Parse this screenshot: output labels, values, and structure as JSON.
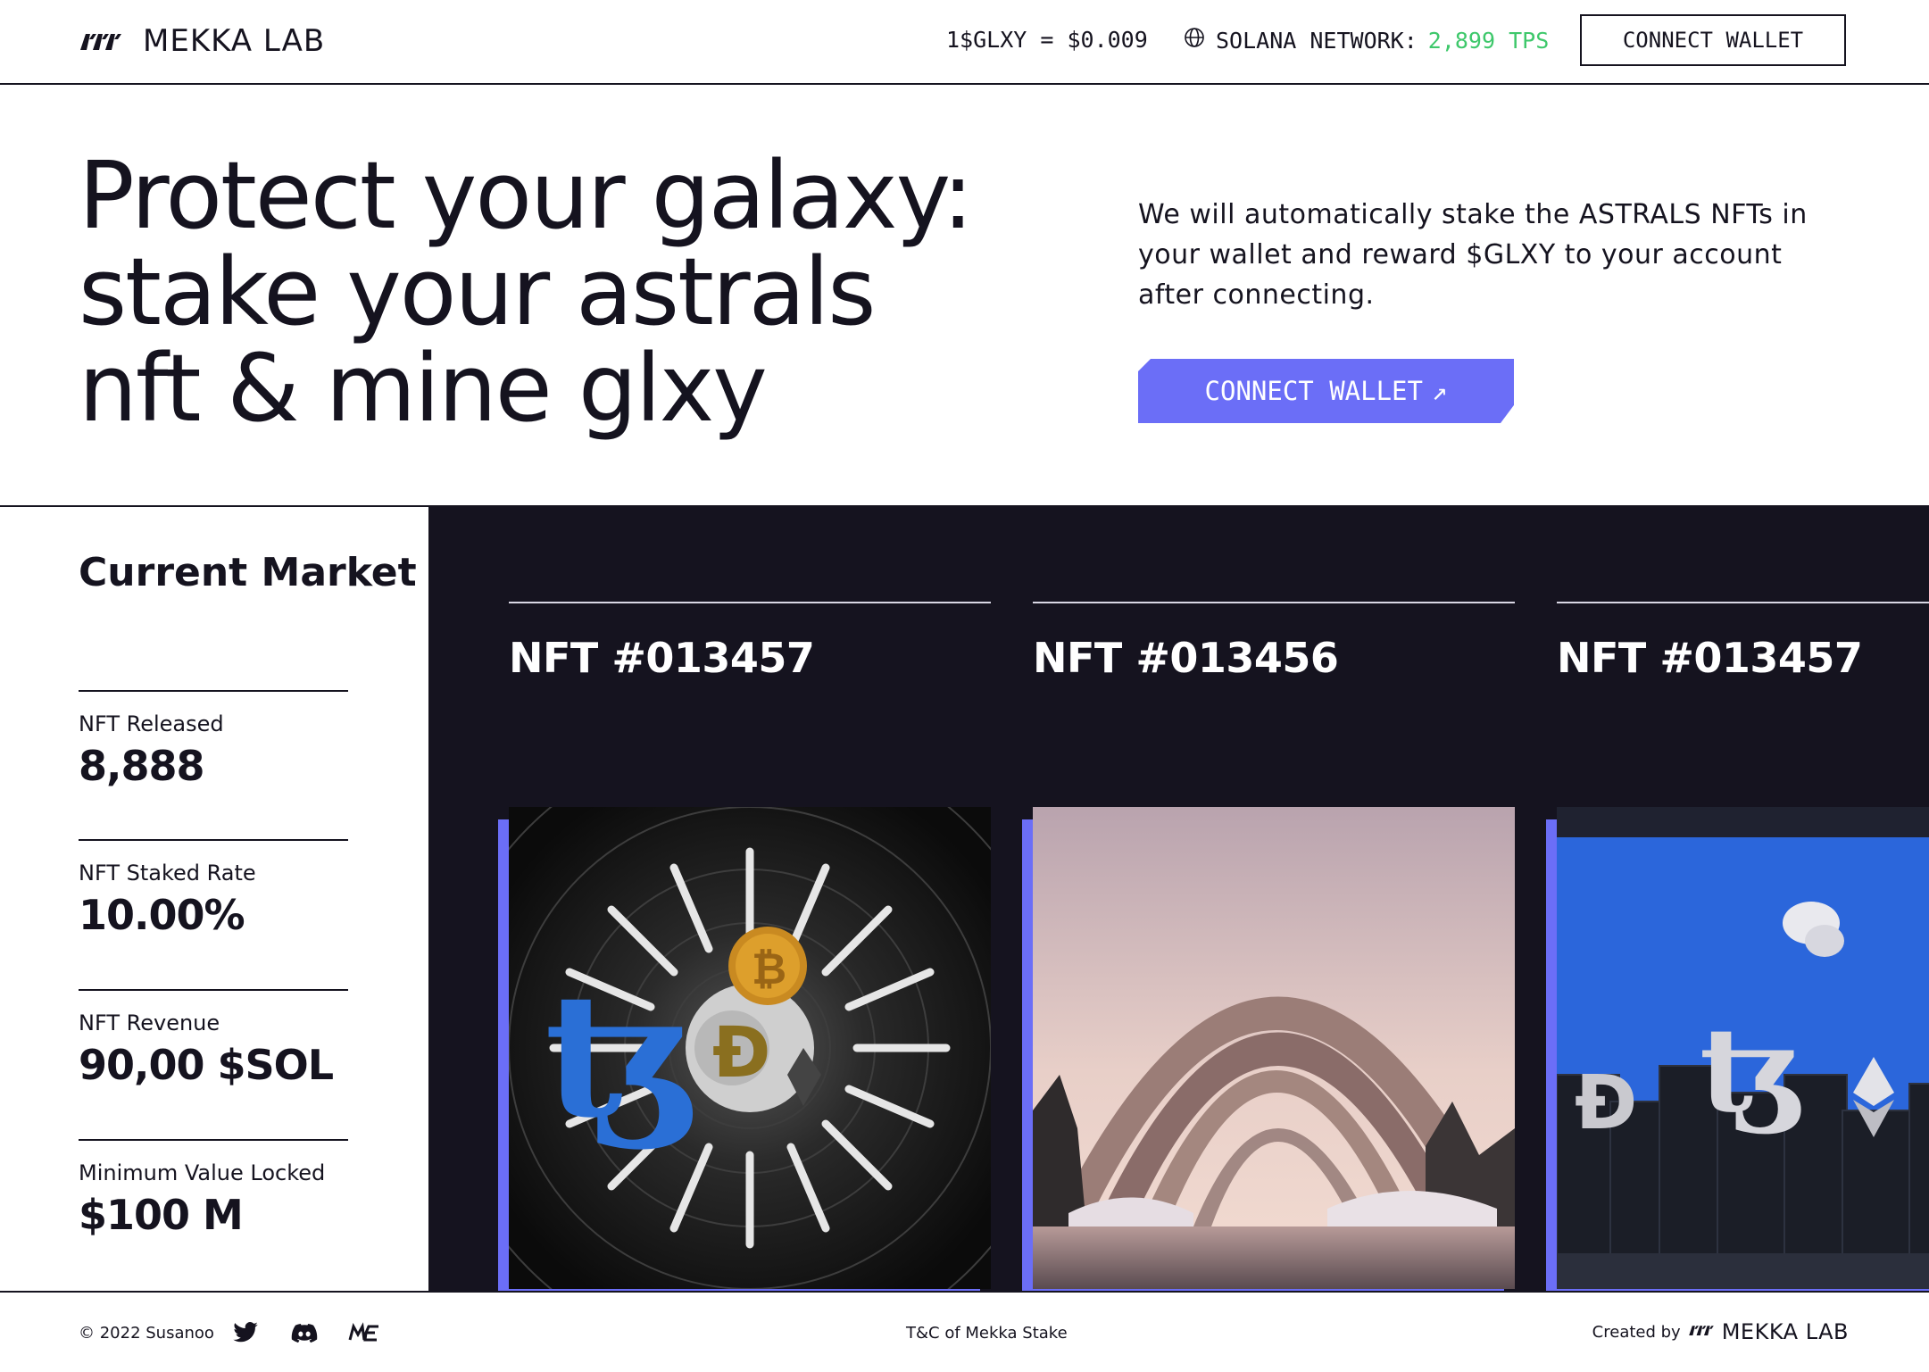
{
  "header": {
    "logo_text": "MEKKA LAB",
    "price": "1$GLXY = $0.009",
    "network_label": "SOLANA NETWORK:",
    "network_tps": "2,899 TPS",
    "wallet_button": "CONNECT WALLET"
  },
  "hero": {
    "title_lines": [
      "Protect your galaxy:",
      "stake your astrals",
      "nft & mine glxy"
    ],
    "description": "We will automatically stake the ASTRALS NFTs in your wallet and reward $GLXY to your account after connecting.",
    "cta_label": "CONNECT WALLET",
    "cta_arrow": "↗"
  },
  "market": {
    "title": "Current Market",
    "stats": [
      {
        "label": "NFT Released",
        "value": "8,888"
      },
      {
        "label": "NFT Staked Rate",
        "value": "10.00%"
      },
      {
        "label": "NFT Revenue",
        "value": "90,00 $SOL"
      },
      {
        "label": "Minimum Value Locked",
        "value": "$100 M"
      }
    ]
  },
  "nfts": [
    {
      "title": "NFT #013457",
      "image": "crypto-tunnel"
    },
    {
      "title": "NFT #013456",
      "image": "stone-arches-landscape"
    },
    {
      "title": "NFT #013457",
      "image": "crypto-city-blocks"
    }
  ],
  "footer": {
    "copyright": "© 2022 Susanoo",
    "social": [
      "twitter-icon",
      "discord-icon",
      "magic-eden-icon"
    ],
    "terms": "T&C of Mekka Stake",
    "credit_prefix": "Created by",
    "credit_brand": "MEKKA LAB"
  },
  "colors": {
    "ink": "#15131f",
    "accent": "#6b6ef7",
    "tps_green": "#3ec86b",
    "background": "#ffffff"
  }
}
